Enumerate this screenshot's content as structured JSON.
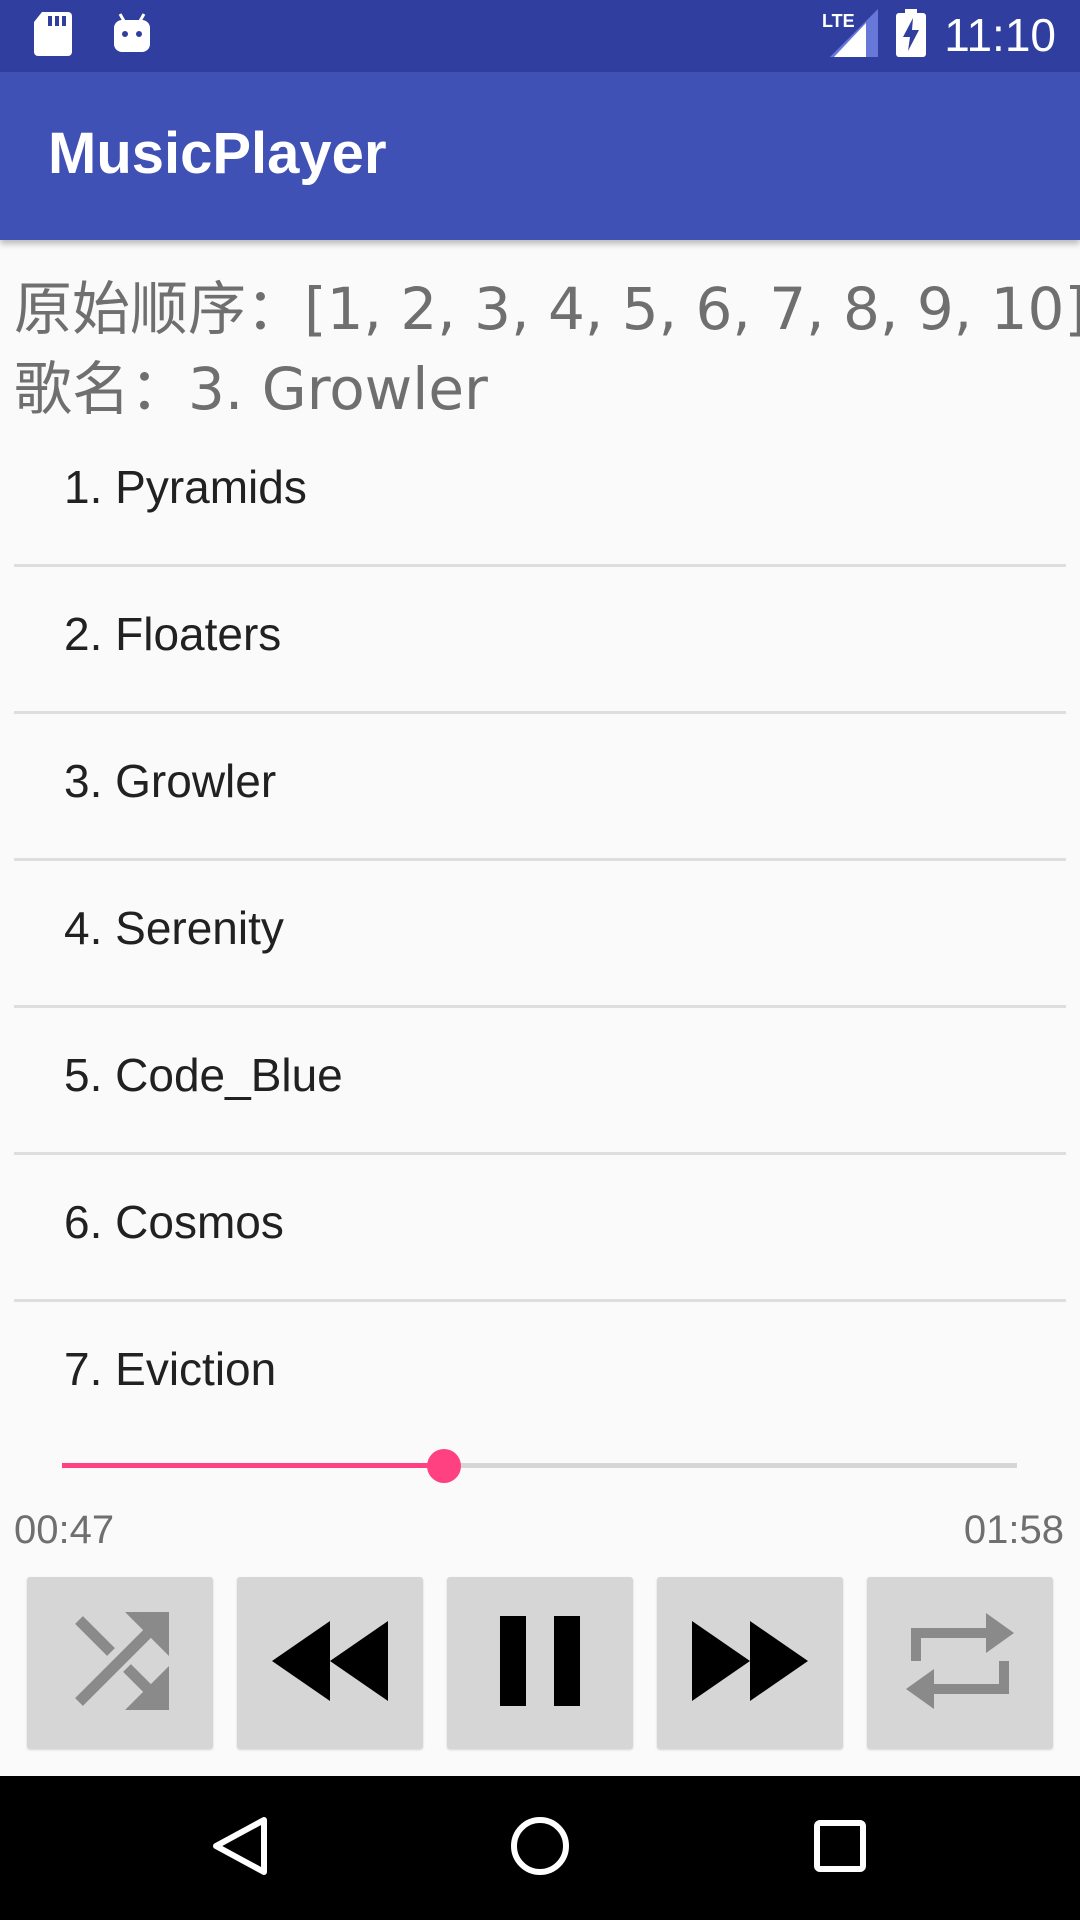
{
  "status_bar": {
    "time": "11:10",
    "network": "LTE",
    "icons": [
      "sd-card-icon",
      "android-debug-icon",
      "lte-signal-icon",
      "battery-charging-icon"
    ]
  },
  "app_bar": {
    "title": "MusicPlayer"
  },
  "info": {
    "original_order": "原始顺序：[1, 2, 3, 4, 5, 6, 7, 8, 9, 10]",
    "song_name": "歌名：3. Growler"
  },
  "songs": [
    "1. Pyramids",
    "2. Floaters",
    "3. Growler",
    "4. Serenity",
    "5. Code_Blue",
    "6. Cosmos",
    "7. Eviction"
  ],
  "player": {
    "elapsed": "00:47",
    "total": "01:58",
    "progress_fraction": 0.4,
    "progress_color": "#ff4081"
  },
  "controls": {
    "buttons": [
      "shuffle-icon",
      "rewind-icon",
      "pause-icon",
      "fast-forward-icon",
      "repeat-icon"
    ]
  },
  "colors": {
    "status_bar": "#303f9f",
    "app_bar": "#3f51b5",
    "accent": "#ff4081"
  }
}
